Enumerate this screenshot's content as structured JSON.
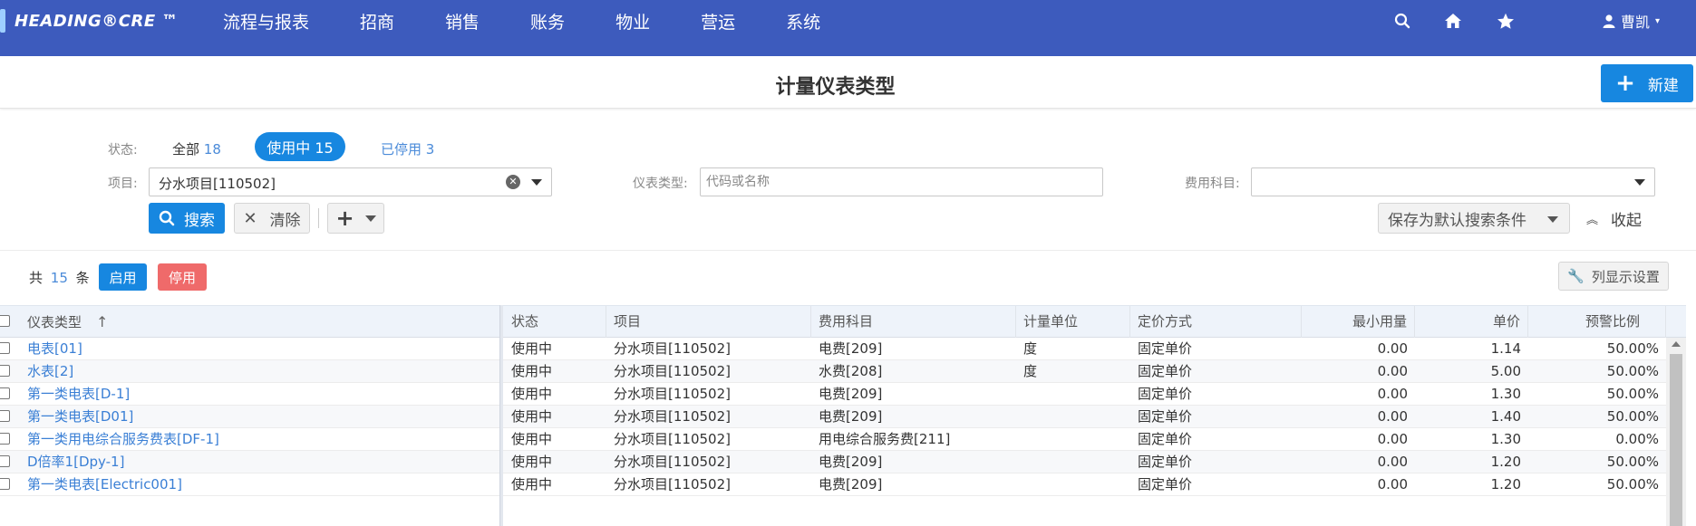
{
  "app": {
    "logo": "HEADING®CRE ™",
    "nav": [
      "流程与报表",
      "招商",
      "销售",
      "账务",
      "物业",
      "营运",
      "系统"
    ],
    "icons": {
      "search": "search-icon",
      "home": "home-icon",
      "favorite": "star-icon",
      "user": "user-icon"
    },
    "user_name": "曹凯"
  },
  "page": {
    "title": "计量仪表类型",
    "new_button": "新建"
  },
  "filters": {
    "status_label": "状态:",
    "status_all": "全部",
    "status_all_count": "18",
    "status_on": "使用中 15",
    "status_off": "已停用",
    "status_off_count": "3",
    "project_label": "项目:",
    "project_value": "分水项目[110502]",
    "meter_type_label": "仪表类型:",
    "meter_type_placeholder": "代码或名称",
    "fee_label": "费用科目:",
    "fee_value": "",
    "search_button": "搜索",
    "clear_button": "清除",
    "save_default_button": "保存为默认搜索条件",
    "collapse_button": "收起"
  },
  "toolbar": {
    "total_prefix": "共",
    "total_count": "15",
    "total_suffix": "条",
    "enable_button": "启用",
    "disable_button": "停用",
    "column_settings_button": "列显示设置"
  },
  "table": {
    "columns": [
      "仪表类型",
      "状态",
      "项目",
      "费用科目",
      "计量单位",
      "定价方式",
      "最小用量",
      "单价",
      "预警比例"
    ],
    "rows": [
      {
        "type": "电表[01]",
        "status": "使用中",
        "project": "分水项目[110502]",
        "fee": "电费[209]",
        "unit": "度",
        "pricing": "固定单价",
        "min": "0.00",
        "price": "1.14",
        "warn": "50.00%"
      },
      {
        "type": "水表[2]",
        "status": "使用中",
        "project": "分水项目[110502]",
        "fee": "水费[208]",
        "unit": "度",
        "pricing": "固定单价",
        "min": "0.00",
        "price": "5.00",
        "warn": "50.00%"
      },
      {
        "type": "第一类电表[D-1]",
        "status": "使用中",
        "project": "分水项目[110502]",
        "fee": "电费[209]",
        "unit": "",
        "pricing": "固定单价",
        "min": "0.00",
        "price": "1.30",
        "warn": "50.00%"
      },
      {
        "type": "第一类电表[D01]",
        "status": "使用中",
        "project": "分水项目[110502]",
        "fee": "电费[209]",
        "unit": "",
        "pricing": "固定单价",
        "min": "0.00",
        "price": "1.40",
        "warn": "50.00%"
      },
      {
        "type": "第一类用电综合服务费表[DF-1]",
        "status": "使用中",
        "project": "分水项目[110502]",
        "fee": "用电综合服务费[211]",
        "unit": "",
        "pricing": "固定单价",
        "min": "0.00",
        "price": "1.30",
        "warn": "0.00%"
      },
      {
        "type": "D倍率1[Dpy-1]",
        "status": "使用中",
        "project": "分水项目[110502]",
        "fee": "电费[209]",
        "unit": "",
        "pricing": "固定单价",
        "min": "0.00",
        "price": "1.20",
        "warn": "50.00%"
      },
      {
        "type": "第一类电表[Electric001]",
        "status": "使用中",
        "project": "分水项目[110502]",
        "fee": "电费[209]",
        "unit": "",
        "pricing": "固定单价",
        "min": "0.00",
        "price": "1.20",
        "warn": "50.00%"
      }
    ]
  },
  "colors": {
    "nav_bg": "#3d5bbd",
    "primary": "#1787e0",
    "danger": "#ef6a6a",
    "link": "#3a7fd5"
  }
}
